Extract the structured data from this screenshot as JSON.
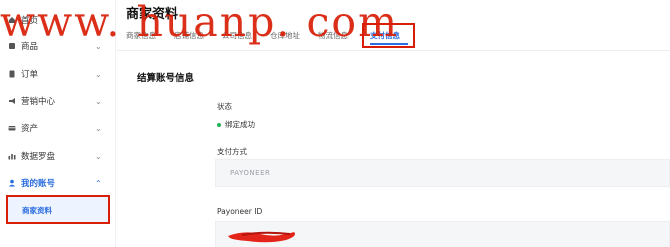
{
  "sidebar": {
    "items": [
      {
        "label": "首页",
        "icon": "home-icon",
        "chevron": ""
      },
      {
        "label": "商品",
        "icon": "box-icon",
        "chevron": "⌄"
      },
      {
        "label": "订单",
        "icon": "order-icon",
        "chevron": "⌄"
      },
      {
        "label": "营销中心",
        "icon": "megaphone-icon",
        "chevron": "⌄"
      },
      {
        "label": "资产",
        "icon": "wallet-icon",
        "chevron": "⌄"
      },
      {
        "label": "数据罗盘",
        "icon": "chart-icon",
        "chevron": "⌄"
      },
      {
        "label": "我的账号",
        "icon": "user-icon",
        "chevron": "⌃"
      }
    ],
    "sub_item": {
      "label": "商家资料"
    }
  },
  "main": {
    "title": "商家资料",
    "tabs": [
      {
        "label": "商家信息"
      },
      {
        "label": "店铺信息"
      },
      {
        "label": "公司信息"
      },
      {
        "label": "仓库地址"
      },
      {
        "label": "物流信息"
      },
      {
        "label": "支付信息"
      }
    ],
    "section_title": "结算账号信息",
    "status": {
      "label": "状态",
      "value": "绑定成功"
    },
    "payment_method": {
      "label": "支付方式",
      "value": "PAYONEER"
    },
    "payoneer_id": {
      "label": "Payoneer ID",
      "value": ""
    }
  },
  "watermark": "www. huanp. com",
  "colors": {
    "accent": "#2b6de0",
    "highlight_box": "#d81e06",
    "success": "#20b35a",
    "watermark": "#d81e06"
  }
}
